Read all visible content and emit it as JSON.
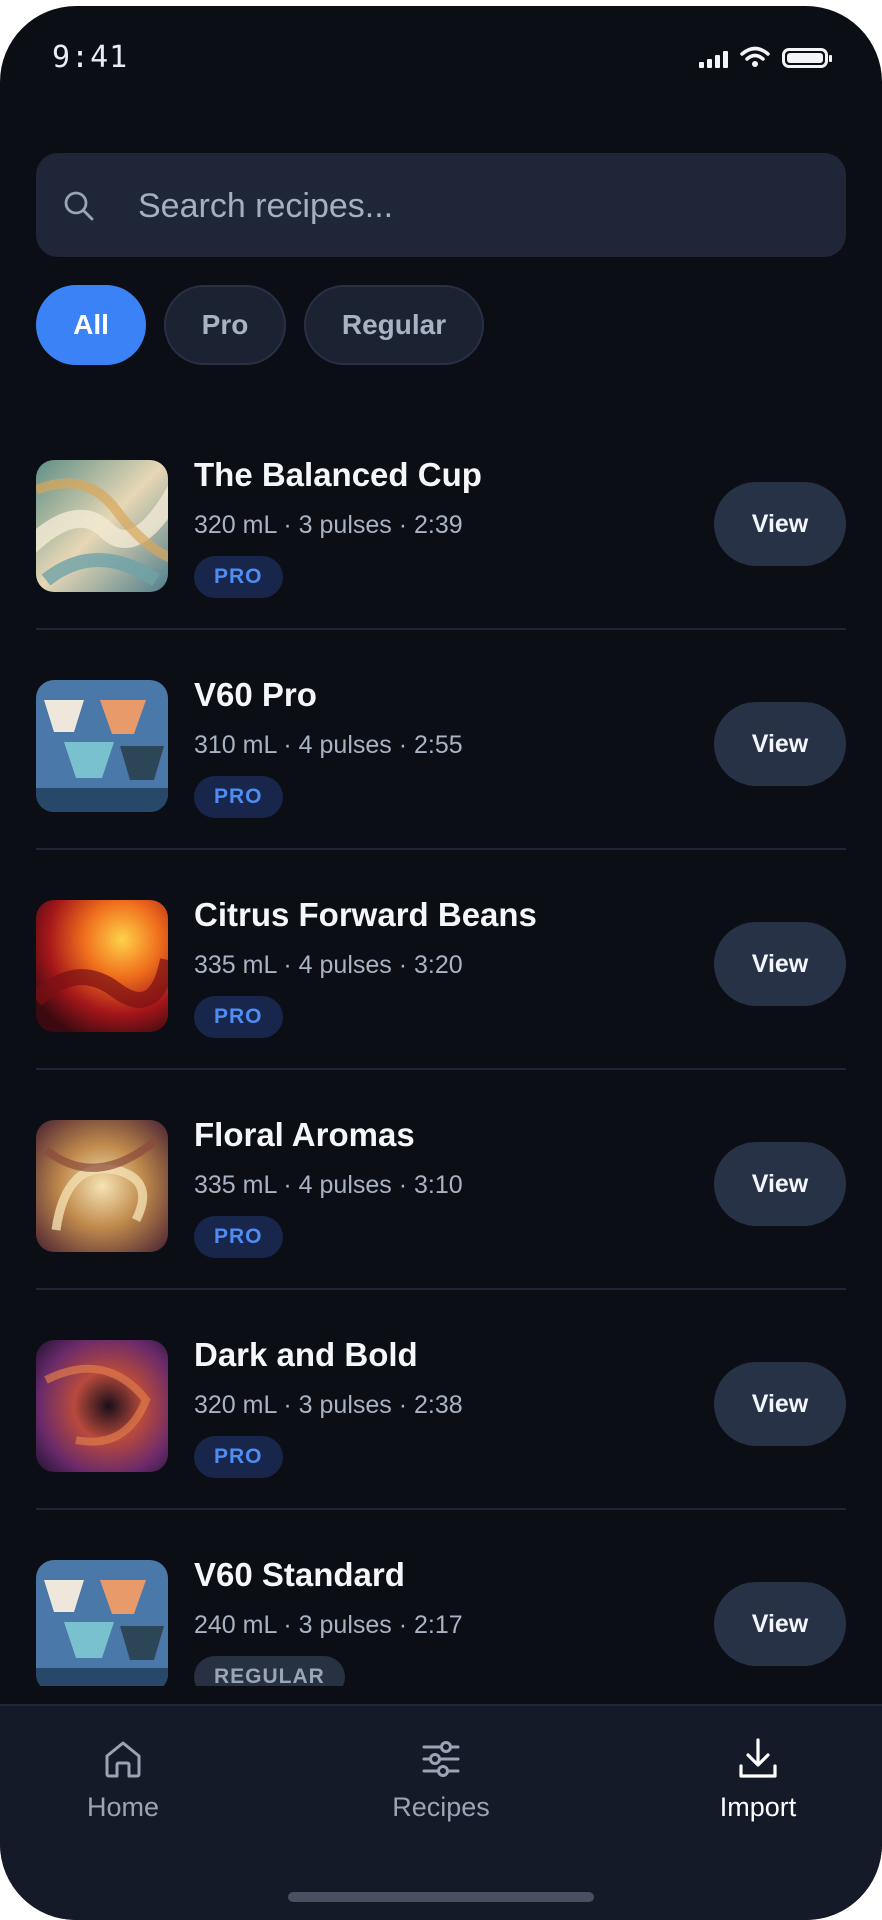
{
  "status_bar": {
    "time": "9:41"
  },
  "search": {
    "placeholder": "Search recipes..."
  },
  "filters": [
    {
      "label": "All",
      "active": true
    },
    {
      "label": "Pro",
      "active": false
    },
    {
      "label": "Regular",
      "active": false
    }
  ],
  "recipes": [
    {
      "title": "The Balanced Cup",
      "meta": "320 mL · 3 pulses · 2:39",
      "badge": "PRO",
      "badge_type": "pro",
      "action": "View",
      "thumb": "swirl-pastel"
    },
    {
      "title": "V60 Pro",
      "meta": "310 mL · 4 pulses · 2:55",
      "badge": "PRO",
      "badge_type": "pro",
      "action": "View",
      "thumb": "v60-drippers"
    },
    {
      "title": "Citrus Forward Beans",
      "meta": "335 mL · 4 pulses · 3:20",
      "badge": "PRO",
      "badge_type": "pro",
      "action": "View",
      "thumb": "fire-red"
    },
    {
      "title": "Floral Aromas",
      "meta": "335 mL · 4 pulses · 3:10",
      "badge": "PRO",
      "badge_type": "pro",
      "action": "View",
      "thumb": "swirl-gold"
    },
    {
      "title": "Dark and Bold",
      "meta": "320 mL · 3 pulses · 2:38",
      "badge": "PRO",
      "badge_type": "pro",
      "action": "View",
      "thumb": "nebula-purple"
    },
    {
      "title": "V60 Standard",
      "meta": "240 mL · 3 pulses · 2:17",
      "badge": "REGULAR",
      "badge_type": "regular",
      "action": "View",
      "thumb": "v60-drippers"
    }
  ],
  "tabbar": [
    {
      "label": "Home",
      "icon": "home-icon",
      "active": false
    },
    {
      "label": "Recipes",
      "icon": "sliders-icon",
      "active": false
    },
    {
      "label": "Import",
      "icon": "download-icon",
      "active": true
    }
  ],
  "colors": {
    "background": "#0b0e15",
    "accent": "#3a82f6",
    "surface": "#1e2637",
    "pro_badge_text": "#4f8df5"
  }
}
